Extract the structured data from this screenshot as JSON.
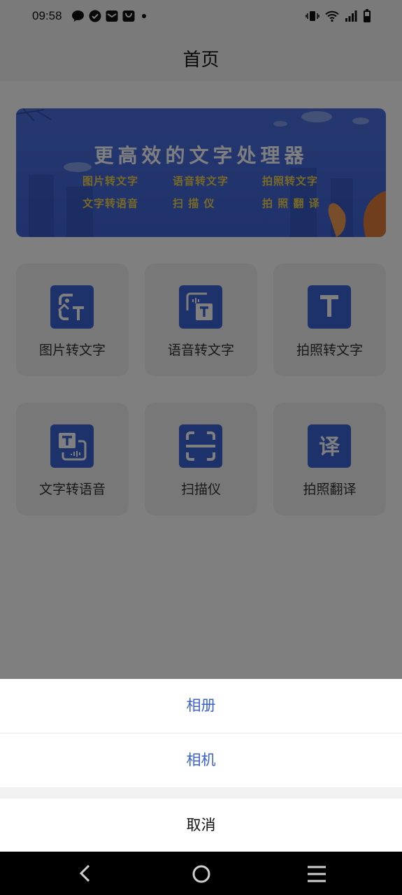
{
  "status_bar": {
    "time": "09:58"
  },
  "nav": {
    "title": "首页"
  },
  "banner": {
    "title": "更高效的文字处理器",
    "features": [
      "图片转文字",
      "语音转文字",
      "拍照转文字",
      "文字转语音",
      "扫 描 仪",
      "拍 照 翻 译"
    ]
  },
  "grid": [
    {
      "label": "图片转文字",
      "icon": "image-to-text-icon"
    },
    {
      "label": "语音转文字",
      "icon": "voice-to-text-icon"
    },
    {
      "label": "拍照转文字",
      "icon": "photo-to-text-icon"
    },
    {
      "label": "文字转语音",
      "icon": "text-to-voice-icon"
    },
    {
      "label": "扫描仪",
      "icon": "scanner-icon"
    },
    {
      "label": "拍照翻译",
      "icon": "photo-translate-icon"
    }
  ],
  "sheet": {
    "album": "相册",
    "camera": "相机",
    "cancel": "取消"
  },
  "colors": {
    "accent": "#3b63d6",
    "sheet_option_text": "#3a62c9",
    "banner_feature_text": "#f2d54a"
  }
}
